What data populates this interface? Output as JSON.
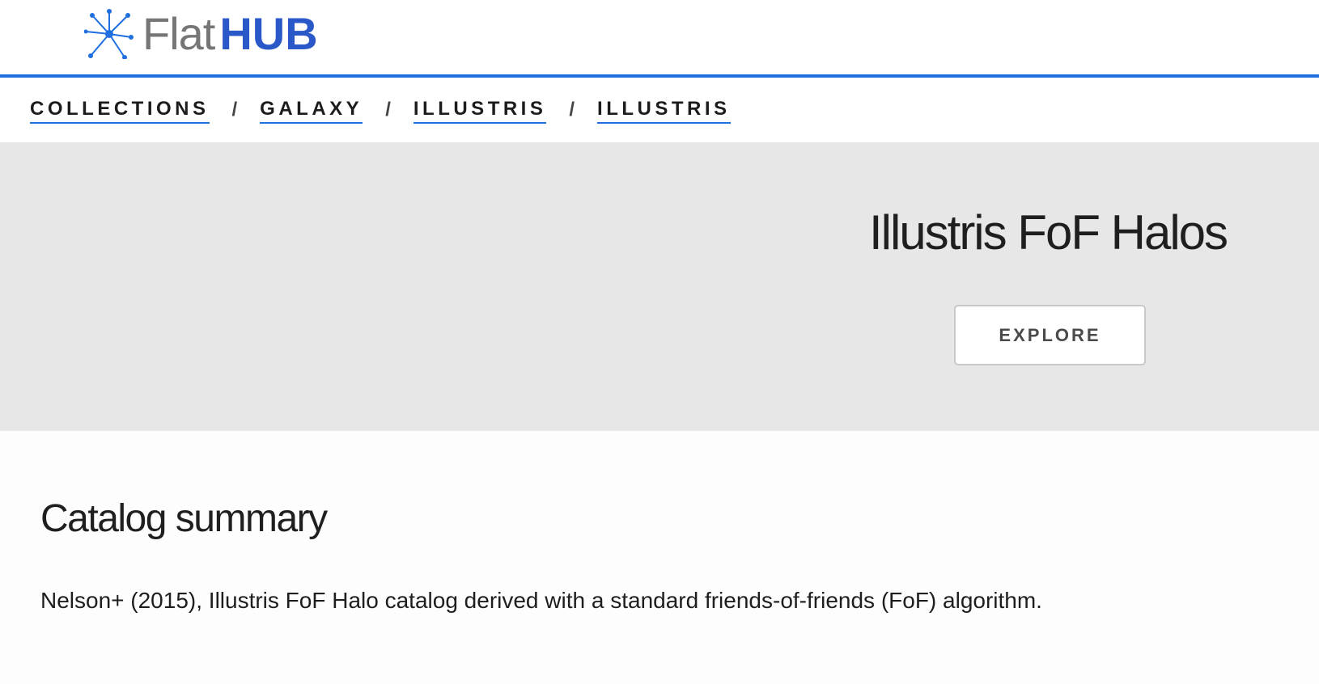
{
  "header": {
    "logo": {
      "text_light": "Flat",
      "text_bold": "HUB",
      "icon": "network-star-icon",
      "colors": {
        "accent_blue": "#1f6fe0",
        "hub_blue": "#2b58c9",
        "flat_gray": "#767676"
      }
    }
  },
  "breadcrumb": {
    "items": [
      {
        "label": "COLLECTIONS"
      },
      {
        "label": "GALAXY"
      },
      {
        "label": "ILLUSTRIS"
      },
      {
        "label": "ILLUSTRIS"
      }
    ],
    "separator": "/"
  },
  "hero": {
    "title": "Illustris FoF Halos",
    "explore_label": "EXPLORE",
    "background": "#e7e7e7"
  },
  "summary": {
    "heading": "Catalog summary",
    "text": "Nelson+ (2015), Illustris FoF Halo catalog derived with a standard friends-of-friends (FoF) algorithm."
  }
}
